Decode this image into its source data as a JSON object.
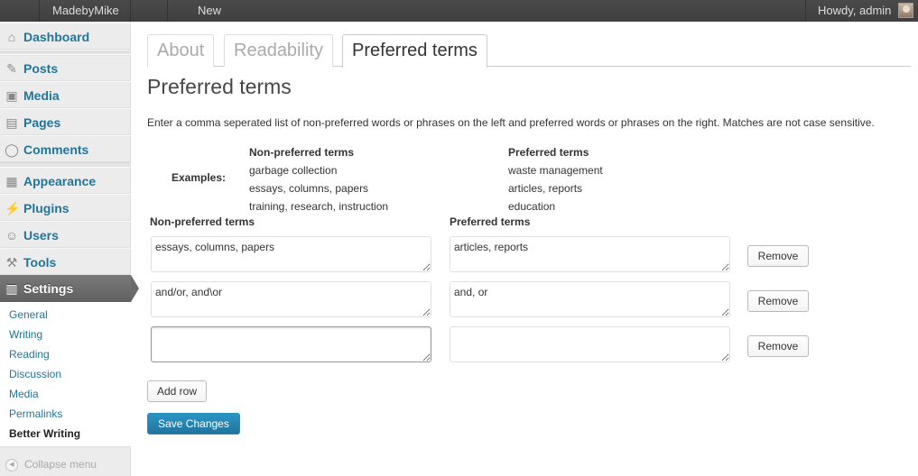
{
  "adminbar": {
    "site_name": "MadebyMike",
    "new_label": "New",
    "greeting": "Howdy, admin"
  },
  "sidebar": {
    "items": [
      {
        "label": "Dashboard",
        "icon": "home-icon"
      },
      {
        "label": "Posts",
        "icon": "pushpin-icon"
      },
      {
        "label": "Media",
        "icon": "media-icon"
      },
      {
        "label": "Pages",
        "icon": "pages-icon"
      },
      {
        "label": "Comments",
        "icon": "speech-bubble-icon"
      },
      {
        "label": "Appearance",
        "icon": "appearance-icon"
      },
      {
        "label": "Plugins",
        "icon": "plug-icon"
      },
      {
        "label": "Users",
        "icon": "users-icon"
      },
      {
        "label": "Tools",
        "icon": "tools-icon"
      },
      {
        "label": "Settings",
        "icon": "settings-icon",
        "active": true
      }
    ],
    "submenu": [
      {
        "label": "General"
      },
      {
        "label": "Writing"
      },
      {
        "label": "Reading"
      },
      {
        "label": "Discussion"
      },
      {
        "label": "Media"
      },
      {
        "label": "Permalinks"
      },
      {
        "label": "Better Writing",
        "current": true
      }
    ],
    "collapse_label": "Collapse menu"
  },
  "tabs": [
    {
      "label": "About"
    },
    {
      "label": "Readability"
    },
    {
      "label": "Preferred terms",
      "active": true
    }
  ],
  "page_title": "Preferred terms",
  "description": "Enter a comma seperated list of non-preferred words or phrases on the left and preferred words or phrases on the right. Matches are not case sensitive.",
  "examples": {
    "label": "Examples:",
    "non_preferred_heading": "Non-preferred terms",
    "preferred_heading": "Preferred terms",
    "non_preferred": [
      "garbage collection",
      "essays, columns, papers",
      "training, research, instruction"
    ],
    "preferred": [
      "waste management",
      "articles, reports",
      "education"
    ]
  },
  "columns": {
    "non_preferred_heading": "Non-preferred terms",
    "preferred_heading": "Preferred terms"
  },
  "rows": [
    {
      "non_preferred": "essays, columns, papers",
      "preferred": "articles, reports",
      "remove_label": "Remove"
    },
    {
      "non_preferred": "and/or, and\\or",
      "preferred": "and, or",
      "remove_label": "Remove"
    },
    {
      "non_preferred": "",
      "preferred": "",
      "remove_label": "Remove"
    }
  ],
  "buttons": {
    "add_row": "Add row",
    "save_changes": "Save Changes"
  },
  "colors": {
    "link": "#21759b",
    "primary_button": "#21759b",
    "admin_bar": "#464646",
    "active_menu": "#6d6d6d"
  }
}
